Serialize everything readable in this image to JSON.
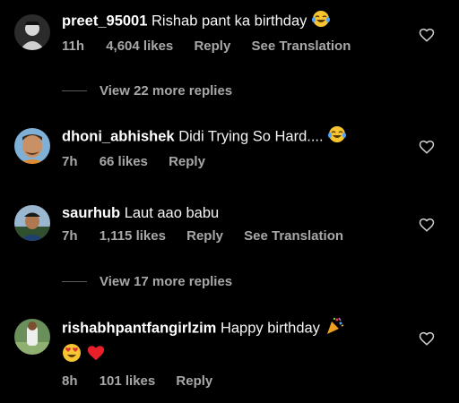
{
  "comments": [
    {
      "username": "preet_95001",
      "text": "Rishab pant ka birthday",
      "emoji": "face-with-tears-of-joy",
      "time": "11h",
      "likes": "4,604 likes",
      "reply": "Reply",
      "translation": "See Translation",
      "view_more": "View 22 more replies"
    },
    {
      "username": "dhoni_abhishek",
      "text": "Didi Trying So Hard....",
      "emoji": "face-with-tears-of-joy",
      "time": "7h",
      "likes": "66 likes",
      "reply": "Reply"
    },
    {
      "username": "saurhub",
      "text": "Laut aao babu",
      "time": "7h",
      "likes": "1,115 likes",
      "reply": "Reply",
      "translation": "See Translation",
      "view_more": "View 17 more replies"
    },
    {
      "username": "rishabhpantfangirlzim",
      "text": "Happy birthday",
      "emoji": "party-popper smiling-face-with-heart-eyes red-heart",
      "time": "8h",
      "likes": "101 likes",
      "reply": "Reply"
    }
  ],
  "colors": {
    "background": "#000000",
    "text": "#f5f5f5",
    "secondary": "#a8a8a8"
  }
}
